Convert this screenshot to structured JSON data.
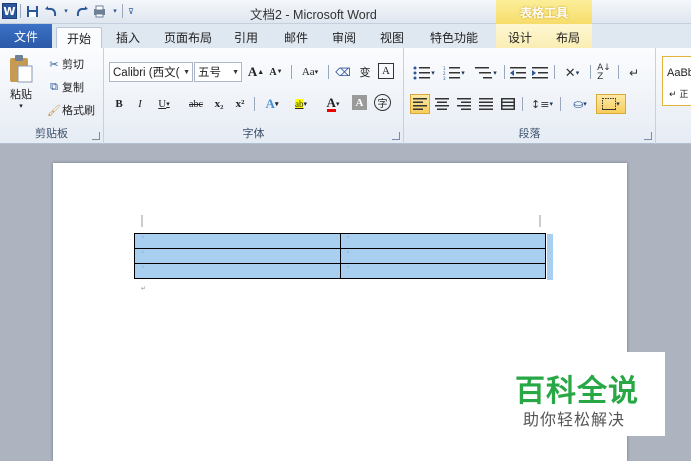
{
  "window": {
    "title": "文档2 - Microsoft Word",
    "contextual_tab_group": "表格工具"
  },
  "tabs": {
    "file": "文件",
    "home": "开始",
    "insert": "插入",
    "page_layout": "页面布局",
    "references": "引用",
    "mailings": "邮件",
    "review": "审阅",
    "view": "视图",
    "special": "特色功能",
    "design": "设计",
    "layout": "布局"
  },
  "clipboard": {
    "paste": "粘贴",
    "cut": "剪切",
    "copy": "复制",
    "format_painter": "格式刷",
    "label": "剪贴板"
  },
  "font": {
    "font_name": "Calibri (西文(",
    "font_size": "五号",
    "label": "字体",
    "grow": "A",
    "shrink": "A",
    "change_case": "Aa",
    "bold": "B",
    "italic": "I",
    "underline": "U",
    "strikethrough": "abc",
    "subscript": "x₂",
    "superscript": "x²",
    "highlight": "ab",
    "font_color": "A",
    "char_shading": "A",
    "enclose": "字",
    "phonetic": "变",
    "char_border": "A"
  },
  "paragraph": {
    "label": "段落"
  },
  "styles": {
    "preview": "AaBb",
    "sub": "↵ 正"
  },
  "document": {
    "rows": 3,
    "cols": 2
  },
  "watermark": {
    "title": "百科全说",
    "subtitle": "助你轻松解决"
  },
  "colors": {
    "accent": "#2b579a",
    "table_fill": "#a9cff0",
    "contextual": "#f6dc6a",
    "watermark_green": "#28a745"
  }
}
